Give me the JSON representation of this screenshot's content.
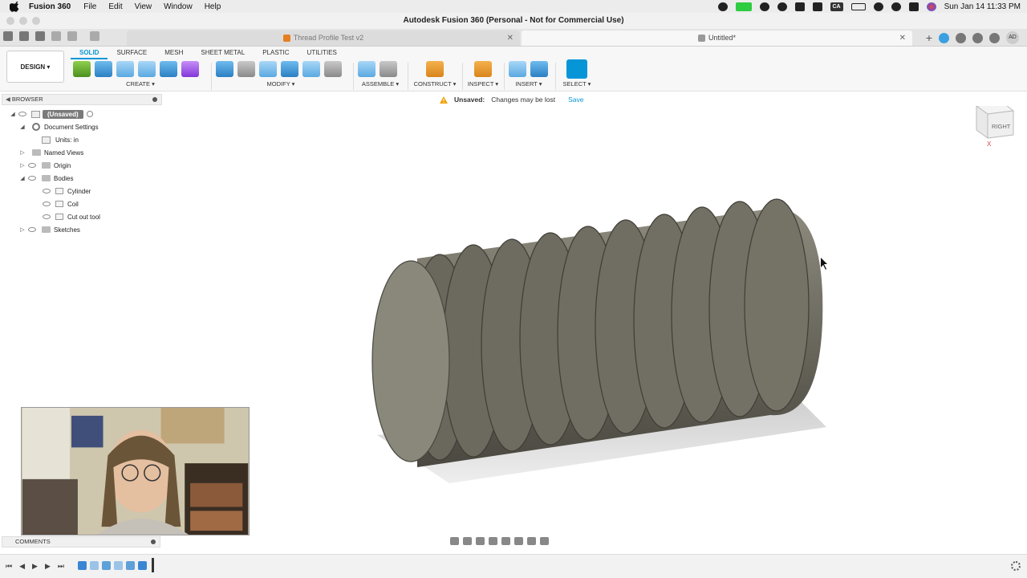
{
  "menubar": {
    "app_name": "Fusion 360",
    "menus": [
      "File",
      "Edit",
      "View",
      "Window",
      "Help"
    ],
    "clock": "Sun Jan 14  11:33 PM",
    "badge": "CA"
  },
  "window": {
    "title": "Autodesk Fusion 360 (Personal - Not for Commercial Use)"
  },
  "tabs": [
    {
      "label": "Thread Profile Test v2",
      "state": "inactive"
    },
    {
      "label": "Untitled*",
      "state": "active"
    }
  ],
  "account": {
    "initials": "AD"
  },
  "toolbar": {
    "workspace": "DESIGN ▾",
    "ribbon_tabs": [
      "SOLID",
      "SURFACE",
      "MESH",
      "SHEET METAL",
      "PLASTIC",
      "UTILITIES"
    ],
    "groups": {
      "create": "CREATE ▾",
      "modify": "MODIFY ▾",
      "assemble": "ASSEMBLE ▾",
      "construct": "CONSTRUCT ▾",
      "inspect": "INSPECT ▾",
      "insert": "INSERT ▾",
      "select": "SELECT ▾"
    }
  },
  "unsaved_bar": {
    "title": "Unsaved:",
    "message": "Changes may be lost",
    "action": "Save"
  },
  "browser": {
    "header": "BROWSER",
    "root": "(Unsaved)",
    "document_settings": "Document Settings",
    "units": "Units: in",
    "named_views": "Named Views",
    "origin": "Origin",
    "bodies": "Bodies",
    "body_items": [
      "Cylinder",
      "Coil",
      "Cut out tool"
    ],
    "sketches": "Sketches"
  },
  "viewcube": {
    "face": "RIGHT",
    "axis_z": "Z",
    "axis_x": "X"
  },
  "comments": {
    "label": "COMMENTS"
  },
  "colors": {
    "accent": "#0696d7",
    "model": "#6e6b60",
    "model_face": "#8a877b"
  }
}
